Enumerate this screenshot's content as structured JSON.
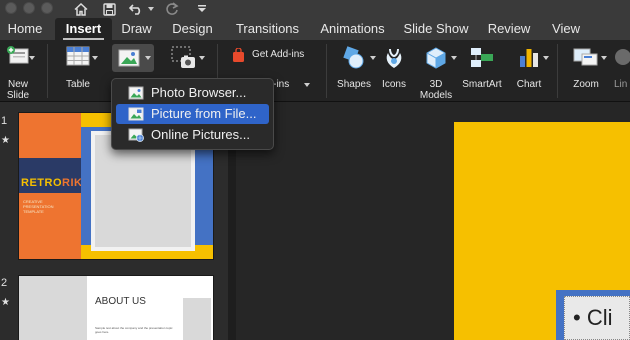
{
  "tabs": [
    "Home",
    "Insert",
    "Draw",
    "Design",
    "Transitions",
    "Animations",
    "Slide Show",
    "Review",
    "View"
  ],
  "active_tab": "Insert",
  "ribbon": {
    "new_slide": "New\nSlide",
    "table": "Table",
    "get_addins": "Get Add-ins",
    "my_addins_partial": "dd-ins",
    "shapes": "Shapes",
    "icons": "Icons",
    "models": "3D\nModels",
    "smartart": "SmartArt",
    "chart": "Chart",
    "zoom": "Zoom",
    "link_partial": "Lin"
  },
  "picture_menu": {
    "items": [
      {
        "label": "Photo Browser...",
        "icon": "photo-browser-icon"
      },
      {
        "label": "Picture from File...",
        "icon": "picture-file-icon"
      },
      {
        "label": "Online Pictures...",
        "icon": "online-pictures-icon"
      }
    ],
    "highlighted": "Picture from File..."
  },
  "thumbnails": [
    {
      "number": "1",
      "title_a": "RETRO",
      "title_b": "RIK",
      "subtitle": "CREATIVE PRESENTATION TEMPLATE"
    },
    {
      "number": "2",
      "title": "ABOUT US",
      "body": "Sample text about the company and the presentation topic goes here."
    }
  ],
  "editor": {
    "bullet_text": "Cli"
  },
  "colors": {
    "accent": "#2f64c9",
    "slide_yellow": "#f6c000",
    "slide_blue": "#4472c4",
    "thumb_orange": "#ee7430",
    "thumb_navy": "#2a3a66"
  }
}
